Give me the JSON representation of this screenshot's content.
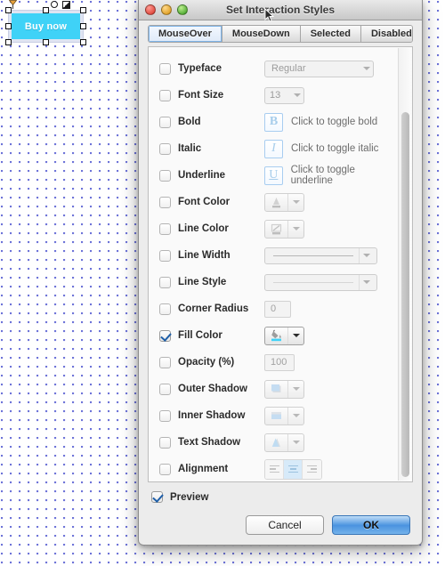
{
  "canvas": {
    "widget": {
      "label": "Buy now",
      "fill_color": "#3fd2f7",
      "selected": true
    },
    "grid_dot_color": "#6e74d8"
  },
  "dialog": {
    "title": "Set Interaction Styles",
    "window_controls": [
      "close",
      "minimize",
      "zoom"
    ],
    "tabs": [
      {
        "label": "MouseOver",
        "active": true
      },
      {
        "label": "MouseDown",
        "active": false
      },
      {
        "label": "Selected",
        "active": false
      },
      {
        "label": "Disabled",
        "active": false
      }
    ],
    "rows": [
      {
        "label": "Typeface",
        "checked": false,
        "control": "select",
        "value": "Regular"
      },
      {
        "label": "Font Size",
        "checked": false,
        "control": "select",
        "value": "13"
      },
      {
        "label": "Bold",
        "checked": false,
        "control": "glyph",
        "glyph": "B",
        "hint": "Click to toggle bold"
      },
      {
        "label": "Italic",
        "checked": false,
        "control": "glyph",
        "glyph": "I",
        "hint": "Click to toggle italic"
      },
      {
        "label": "Underline",
        "checked": false,
        "control": "glyph",
        "glyph": "U",
        "hint": "Click to toggle underline"
      },
      {
        "label": "Font Color",
        "checked": false,
        "control": "combo",
        "icon": "font-color-icon"
      },
      {
        "label": "Line Color",
        "checked": false,
        "control": "combo",
        "icon": "line-color-icon"
      },
      {
        "label": "Line Width",
        "checked": false,
        "control": "lineselect",
        "value": ""
      },
      {
        "label": "Line Style",
        "checked": false,
        "control": "lineselect",
        "value": ""
      },
      {
        "label": "Corner Radius",
        "checked": false,
        "control": "field",
        "value": "0"
      },
      {
        "label": "Fill Color",
        "checked": true,
        "control": "combo",
        "icon": "paint-bucket-icon"
      },
      {
        "label": "Opacity (%)",
        "checked": false,
        "control": "field",
        "value": "100"
      },
      {
        "label": "Outer Shadow",
        "checked": false,
        "control": "combo",
        "icon": "outer-shadow-icon"
      },
      {
        "label": "Inner Shadow",
        "checked": false,
        "control": "combo",
        "icon": "inner-shadow-icon"
      },
      {
        "label": "Text Shadow",
        "checked": false,
        "control": "combo",
        "icon": "text-shadow-icon"
      },
      {
        "label": "Alignment",
        "checked": false,
        "control": "align",
        "selected_option": "center",
        "options": [
          "left",
          "center",
          "right"
        ]
      }
    ],
    "footer": {
      "preview_label": "Preview",
      "preview_checked": true,
      "cancel_label": "Cancel",
      "ok_label": "OK"
    },
    "accent_color": "#4b93e0"
  }
}
